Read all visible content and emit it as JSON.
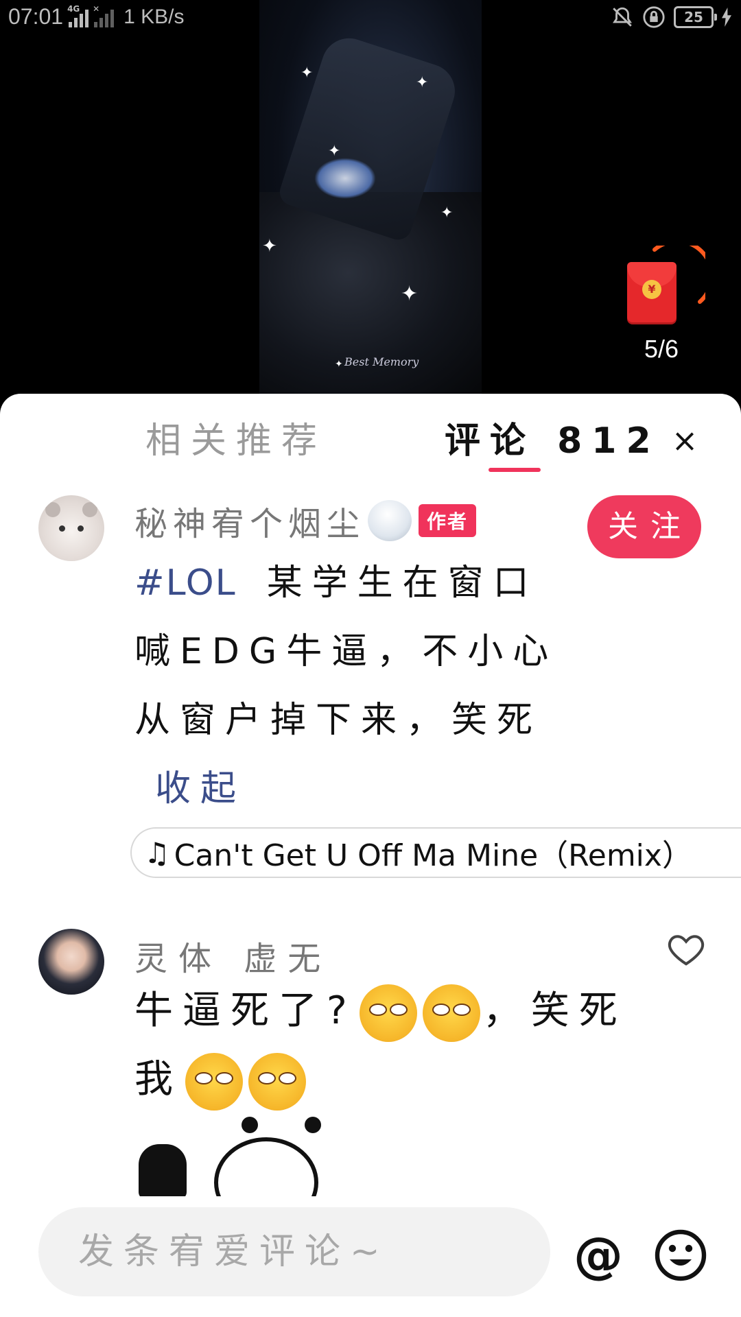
{
  "status_bar": {
    "time": "07:01",
    "network": "4G",
    "speed": "1 KB/s",
    "battery": "25"
  },
  "video": {
    "watermark": "Best Memory"
  },
  "red_packet": {
    "count": "5/6",
    "coin_symbol": "¥"
  },
  "tabs": {
    "recommend": "相关推荐",
    "comments": "评论 812",
    "close": "×"
  },
  "post": {
    "author": "秘神宥个烟尘",
    "author_badge": "作者",
    "follow_label": "关注",
    "hashtag": "#LOL",
    "text": "某学生在窗口喊EDG牛逼，不小心从窗户掉下来，笑死",
    "collapse_label": "收起",
    "music": "Can't Get U Off Ma Mine（Remix）"
  },
  "reply": {
    "author": "灵体 虚无",
    "text_part1": "牛逼死了?",
    "text_part2": "，笑死",
    "text_part3": "我"
  },
  "input": {
    "placeholder": "发条宥爱评论~",
    "at_symbol": "@"
  },
  "colors": {
    "accent": "#f0335b",
    "link": "#3b4d8a"
  }
}
